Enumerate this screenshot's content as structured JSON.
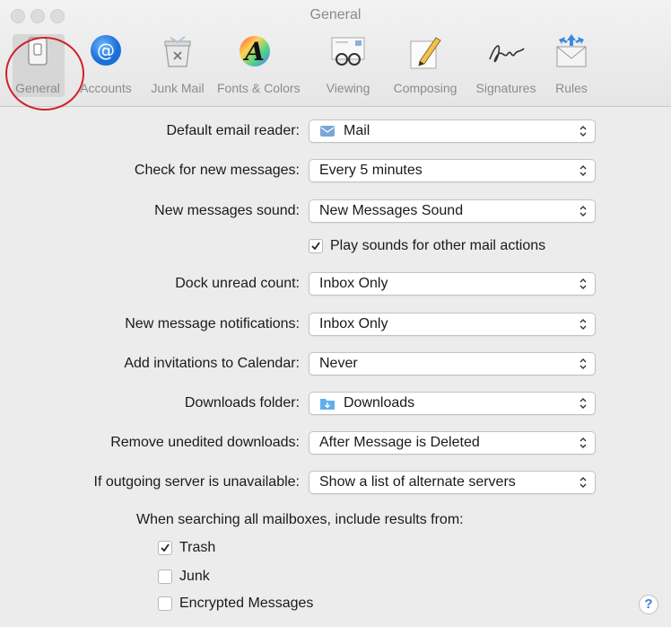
{
  "window": {
    "title": "General"
  },
  "toolbar": {
    "items": [
      {
        "label": "General",
        "icon": "switch-icon"
      },
      {
        "label": "Accounts",
        "icon": "at-sign-icon"
      },
      {
        "label": "Junk Mail",
        "icon": "junk-bin-icon"
      },
      {
        "label": "Fonts & Colors",
        "icon": "font-color-icon"
      },
      {
        "label": "Viewing",
        "icon": "glasses-icon"
      },
      {
        "label": "Composing",
        "icon": "pencil-paper-icon"
      },
      {
        "label": "Signatures",
        "icon": "signature-icon"
      },
      {
        "label": "Rules",
        "icon": "rules-envelope-icon"
      }
    ],
    "selected": "General",
    "highlight_color": "#d3202a"
  },
  "settings": {
    "default_reader": {
      "label": "Default email reader:",
      "value": "Mail"
    },
    "check_messages": {
      "label": "Check for new messages:",
      "value": "Every 5 minutes"
    },
    "messages_sound": {
      "label": "New messages sound:",
      "value": "New Messages Sound"
    },
    "play_sounds": {
      "label": "Play sounds for other mail actions",
      "checked": true
    },
    "dock_unread": {
      "label": "Dock unread count:",
      "value": "Inbox Only"
    },
    "notifications": {
      "label": "New message notifications:",
      "value": "Inbox Only"
    },
    "invitations": {
      "label": "Add invitations to Calendar:",
      "value": "Never"
    },
    "downloads_folder": {
      "label": "Downloads folder:",
      "value": "Downloads"
    },
    "remove_downloads": {
      "label": "Remove unedited downloads:",
      "value": "After Message is Deleted"
    },
    "outgoing_server": {
      "label": "If outgoing server is unavailable:",
      "value": "Show a list of alternate servers"
    }
  },
  "search": {
    "heading": "When searching all mailboxes, include results from:",
    "options": [
      {
        "label": "Trash",
        "checked": true
      },
      {
        "label": "Junk",
        "checked": false
      },
      {
        "label": "Encrypted Messages",
        "checked": false
      }
    ]
  },
  "help": {
    "label": "?"
  }
}
